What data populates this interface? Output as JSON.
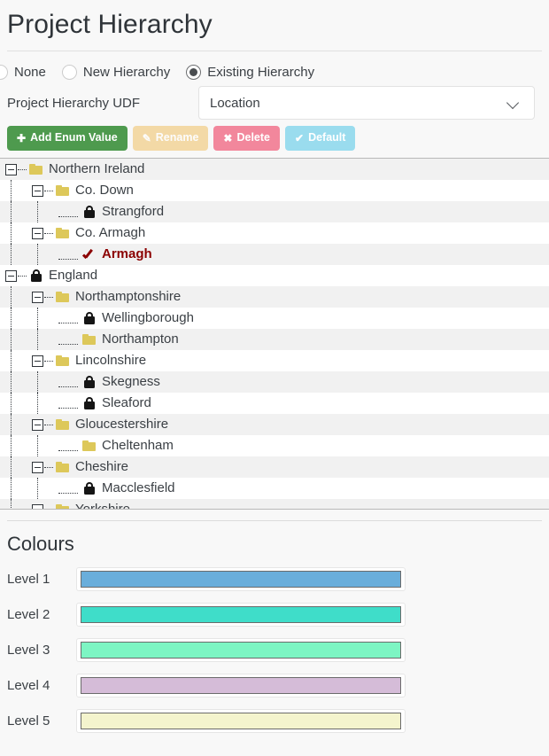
{
  "header": {
    "title": "Project Hierarchy"
  },
  "hierarchy_mode": {
    "options": [
      {
        "label": "None",
        "checked": false
      },
      {
        "label": "New Hierarchy",
        "checked": false
      },
      {
        "label": "Existing Hierarchy",
        "checked": true
      }
    ]
  },
  "udf": {
    "label": "Project Hierarchy UDF",
    "selected": "Location",
    "chevron_icon": "chevron-down-icon"
  },
  "toolbar": {
    "add_label": "Add Enum Value",
    "add_glyph": "➕",
    "add_icon": "plus-icon",
    "add_color": "#4e9a4e",
    "rename_label": "Rename",
    "rename_glyph": "✎",
    "rename_icon": "pencil-icon",
    "rename_color": "#f3d9a6",
    "delete_label": "Delete",
    "delete_glyph": "✖",
    "delete_icon": "cross-icon",
    "delete_color": "#f2879c",
    "default_label": "Default",
    "default_glyph": "✔",
    "default_icon": "check-icon",
    "default_color": "#9adcee"
  },
  "tree": {
    "nodes": [
      {
        "label": "Northern Ireland",
        "level": 0,
        "icon": "folder-icon",
        "expander": true,
        "selected": false
      },
      {
        "label": "Co. Down",
        "level": 1,
        "icon": "folder-icon",
        "expander": true,
        "selected": false
      },
      {
        "label": "Strangford",
        "level": 2,
        "icon": "lock-icon",
        "expander": false,
        "selected": false
      },
      {
        "label": "Co. Armagh",
        "level": 1,
        "icon": "folder-icon",
        "expander": true,
        "selected": false
      },
      {
        "label": "Armagh",
        "level": 2,
        "icon": "check-icon",
        "expander": false,
        "selected": true
      },
      {
        "label": "England",
        "level": 0,
        "icon": "lock-icon",
        "expander": true,
        "selected": false
      },
      {
        "label": "Northamptonshire",
        "level": 1,
        "icon": "folder-icon",
        "expander": true,
        "selected": false
      },
      {
        "label": "Wellingborough",
        "level": 2,
        "icon": "lock-icon",
        "expander": false,
        "selected": false
      },
      {
        "label": "Northampton",
        "level": 2,
        "icon": "folder-icon",
        "expander": false,
        "selected": false
      },
      {
        "label": "Lincolnshire",
        "level": 1,
        "icon": "folder-icon",
        "expander": true,
        "selected": false
      },
      {
        "label": "Skegness",
        "level": 2,
        "icon": "lock-icon",
        "expander": false,
        "selected": false
      },
      {
        "label": "Sleaford",
        "level": 2,
        "icon": "lock-icon",
        "expander": false,
        "selected": false
      },
      {
        "label": "Gloucestershire",
        "level": 1,
        "icon": "folder-icon",
        "expander": true,
        "selected": false
      },
      {
        "label": "Cheltenham",
        "level": 2,
        "icon": "folder-icon",
        "expander": false,
        "selected": false
      },
      {
        "label": "Cheshire",
        "level": 1,
        "icon": "folder-icon",
        "expander": true,
        "selected": false
      },
      {
        "label": "Macclesfield",
        "level": 2,
        "icon": "lock-icon",
        "expander": false,
        "selected": false
      },
      {
        "label": "Yorkshire",
        "level": 1,
        "icon": "folder-icon",
        "expander": true,
        "selected": false
      }
    ],
    "selected_color": "#8b0000"
  },
  "colours": {
    "title": "Colours",
    "levels": [
      {
        "label": "Level 1",
        "value": "#6aaedb"
      },
      {
        "label": "Level 2",
        "value": "#3fddc9"
      },
      {
        "label": "Level 3",
        "value": "#7df5c3"
      },
      {
        "label": "Level 4",
        "value": "#d5bcd8"
      },
      {
        "label": "Level 5",
        "value": "#f4f4cd"
      }
    ]
  }
}
